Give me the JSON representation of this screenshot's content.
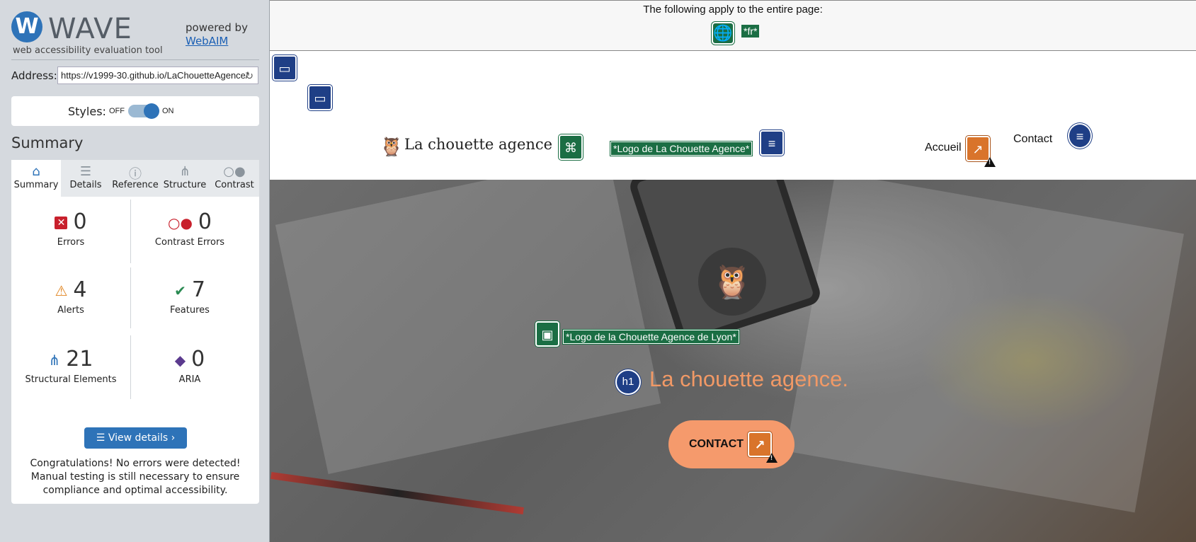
{
  "wave": {
    "logo_letter": "W",
    "logo_word": "WAVE",
    "logo_sub": "web accessibility evaluation tool",
    "powered_by": "powered by",
    "webaim": "WebAIM",
    "address_label": "Address:",
    "address_value": "https://v1999-30.github.io/LaChouetteAgence/",
    "styles_label": "Styles:",
    "styles_off": "OFF",
    "styles_on": "ON",
    "summary_title": "Summary",
    "tabs": [
      {
        "label": "Summary",
        "icon": "home-icon",
        "glyph": "⌂"
      },
      {
        "label": "Details",
        "icon": "list-icon",
        "glyph": "☰"
      },
      {
        "label": "Reference",
        "icon": "info-icon",
        "glyph": "ⓘ"
      },
      {
        "label": "Structure",
        "icon": "structure-icon",
        "glyph": "⋔"
      },
      {
        "label": "Contrast",
        "icon": "contrast-icon",
        "glyph": "○●"
      }
    ],
    "stats": {
      "errors": {
        "value": "0",
        "label": "Errors"
      },
      "contrast_errors": {
        "value": "0",
        "label": "Contrast Errors"
      },
      "alerts": {
        "value": "4",
        "label": "Alerts"
      },
      "features": {
        "value": "7",
        "label": "Features"
      },
      "structural": {
        "value": "21",
        "label": "Structural Elements"
      },
      "aria": {
        "value": "0",
        "label": "ARIA"
      }
    },
    "view_details": "View details ›",
    "congrats": "Congratulations! No errors were detected! Manual testing is still necessary to ensure compliance and optimal accessibility."
  },
  "page": {
    "banner_text": "The following apply to the entire page:",
    "lang_tag": "*fr*",
    "brand_name": "La chouette agence",
    "logo_alt": "*Logo de La Chouette Agence*",
    "nav": {
      "accueil": "Accueil",
      "contact": "Contact"
    },
    "hero_logo_alt": "*Logo de la Chouette Agence de Lyon*",
    "h1_badge": "h1",
    "hero_title": "La chouette agence.",
    "contact_button": "CONTACT"
  },
  "colors": {
    "wave_blue": "#2e73b8",
    "feature_green": "#1b6e44",
    "structure_navy": "#1f3f86",
    "alert_orange": "#d9742b",
    "hero_title": "#f19966",
    "contact_button": "#f59a6c"
  }
}
